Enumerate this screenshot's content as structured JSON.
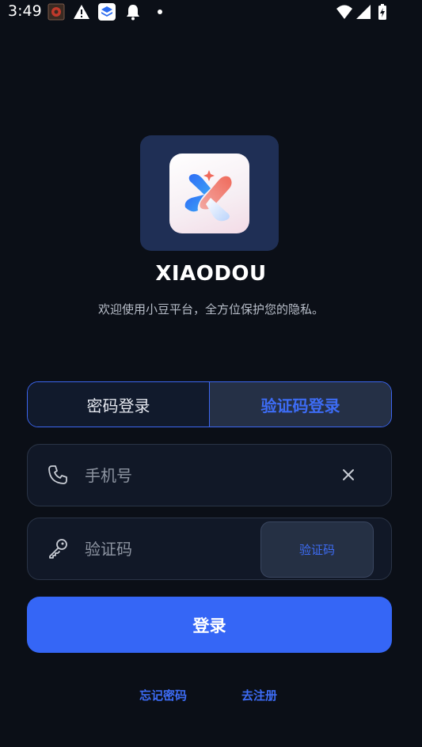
{
  "status_bar": {
    "time": "3:49"
  },
  "app": {
    "title": "XIAODOU",
    "subtitle": "欢迎使用小豆平台，全方位保护您的隐私。"
  },
  "tabs": [
    {
      "label": "密码登录",
      "active": false
    },
    {
      "label": "验证码登录",
      "active": true
    }
  ],
  "phone_field": {
    "placeholder": "手机号",
    "value": ""
  },
  "code_field": {
    "placeholder": "验证码",
    "value": "",
    "send_button": "验证码"
  },
  "login_button": "登录",
  "links": {
    "forgot_password": "忘记密码",
    "register": "去注册"
  },
  "colors": {
    "background": "#0b0f17",
    "accent": "#3566f6",
    "logo_tile": "#1f2f55"
  },
  "icons": {
    "phone": "phone-icon",
    "key": "key-icon",
    "clear": "close-icon"
  }
}
